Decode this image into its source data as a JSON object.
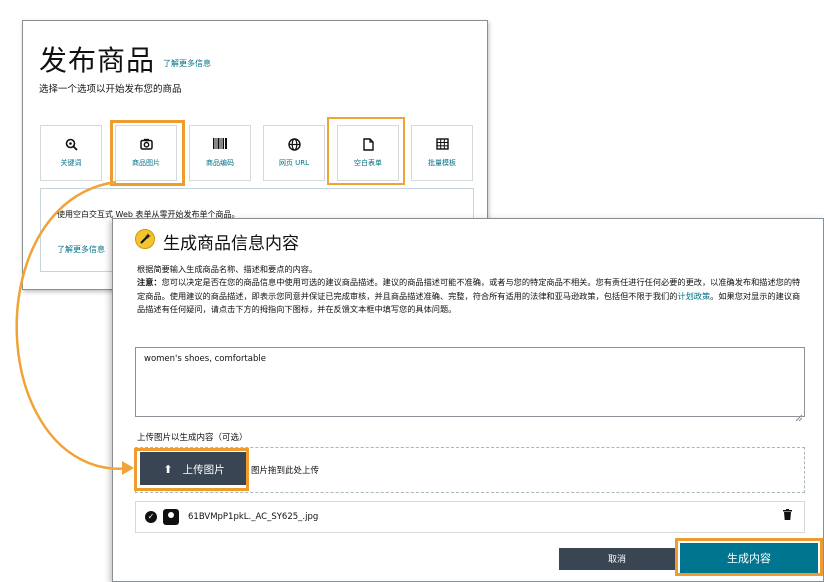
{
  "back_panel": {
    "title": "发布商品",
    "learn_more": "了解更多信息",
    "subtitle": "选择一个选项以开始发布您的商品",
    "options": [
      {
        "label": "关键词",
        "icon": "magnifier-icon"
      },
      {
        "label": "商品图片",
        "icon": "camera-icon"
      },
      {
        "label": "商品编码",
        "icon": "barcode-icon"
      },
      {
        "label": "网页 URL",
        "icon": "globe-icon"
      },
      {
        "label": "空白表单",
        "icon": "document-icon"
      },
      {
        "label": "批量模板",
        "icon": "grid-icon"
      }
    ],
    "description": "使用空白交互式 Web 表单从零开始发布单个商品。",
    "description_learn_more": "了解更多信息"
  },
  "front_panel": {
    "title": "生成商品信息内容",
    "intro": "根据简要输入生成商品名称、描述和要点的内容。",
    "note_label": "注意：",
    "note_text": "您可以决定是否在您的商品信息中使用可选的建议商品描述。建议的商品描述可能不准确，或者与您的特定商品不相关。您有责任进行任何必要的更改，以准确发布和描述您的特定商品。使用建议的商品描述，即表示您同意并保证已完成审核，并且商品描述准确、完整，符合所有适用的法律和亚马逊政策，包括但不限于我们的",
    "note_link": "计划政策",
    "note_tail": "。如果您对显示的建议商品描述有任何疑问，请点击下方的拇指向下图标，并在反馈文本框中填写您的具体问题。",
    "prompt_value": "women's shoes, comfortable",
    "upload_label": "上传图片以生成内容（可选）",
    "upload_button": "上传图片",
    "drag_hint": "图片拖到此处上传",
    "file_name": "61BVMpP1pkL._AC_SY625_.jpg",
    "cancel_button": "取消",
    "generate_button": "生成内容"
  },
  "colors": {
    "highlight": "#f0a336",
    "link": "#007185",
    "button_dark": "#3a4553",
    "button_primary": "#00758f"
  }
}
